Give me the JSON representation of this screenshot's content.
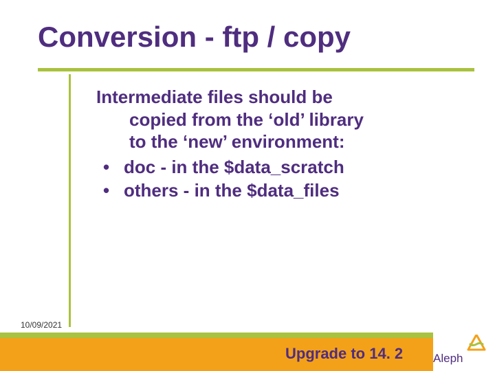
{
  "colors": {
    "purple": "#4f2d7f",
    "green": "#a9c23f",
    "orange": "#f4a11a"
  },
  "title": "Conversion - ftp / copy",
  "lead_line1": "Intermediate files should be",
  "lead_line2": "copied from the ‘old’ library",
  "lead_line3": "to the ‘new’ environment:",
  "bullets": [
    "doc - in the $data_scratch",
    "others - in the $data_files"
  ],
  "date": "10/09/2021",
  "footer_title": "Upgrade to 14. 2",
  "logo_text": "Aleph"
}
